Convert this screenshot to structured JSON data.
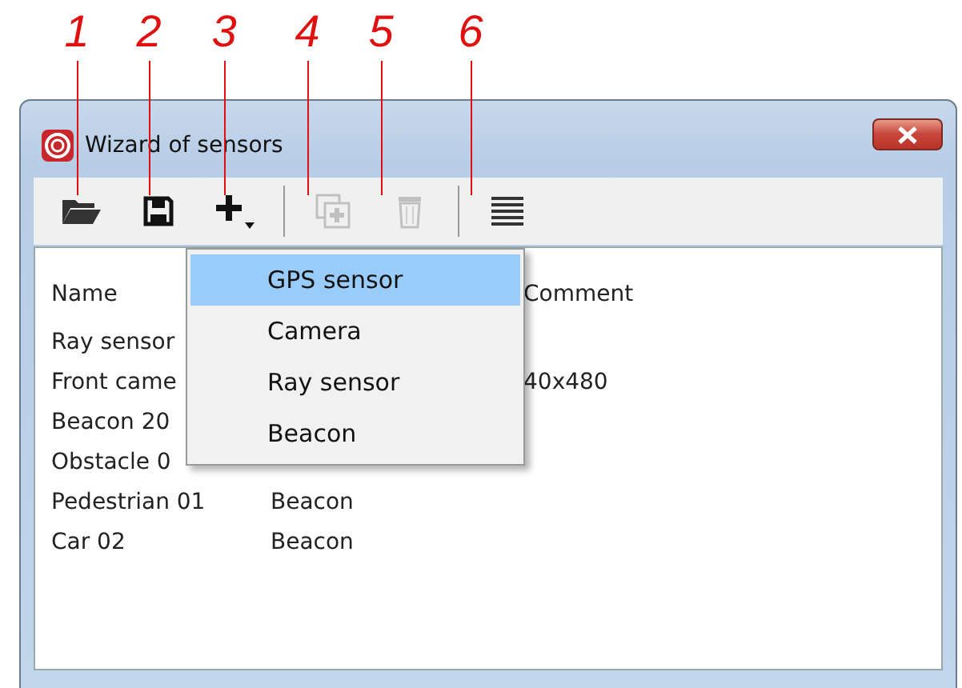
{
  "callouts": [
    "1",
    "2",
    "3",
    "4",
    "5",
    "6"
  ],
  "window": {
    "title": "Wizard of sensors"
  },
  "toolbar": [
    {
      "kind": "open",
      "disabled": false
    },
    {
      "kind": "save",
      "disabled": false
    },
    {
      "kind": "add",
      "disabled": false
    },
    {
      "kind": "sep"
    },
    {
      "kind": "duplicate",
      "disabled": true
    },
    {
      "kind": "delete",
      "disabled": true
    },
    {
      "kind": "sep"
    },
    {
      "kind": "list",
      "disabled": false
    }
  ],
  "table": {
    "columns": [
      "Name",
      "",
      "Comment"
    ],
    "rows": [
      [
        "Ray sensor",
        "",
        ""
      ],
      [
        "Front came",
        "",
        "40x480"
      ],
      [
        "Beacon 20",
        "",
        ""
      ],
      [
        "Obstacle 0",
        "",
        ""
      ],
      [
        "Pedestrian 01",
        "Beacon",
        ""
      ],
      [
        "Car 02",
        "Beacon",
        ""
      ]
    ]
  },
  "menu": {
    "items": [
      {
        "label": "GPS sensor",
        "selected": true
      },
      {
        "label": "Camera",
        "selected": false
      },
      {
        "label": "Ray sensor",
        "selected": false
      },
      {
        "label": "Beacon",
        "selected": false
      }
    ]
  }
}
